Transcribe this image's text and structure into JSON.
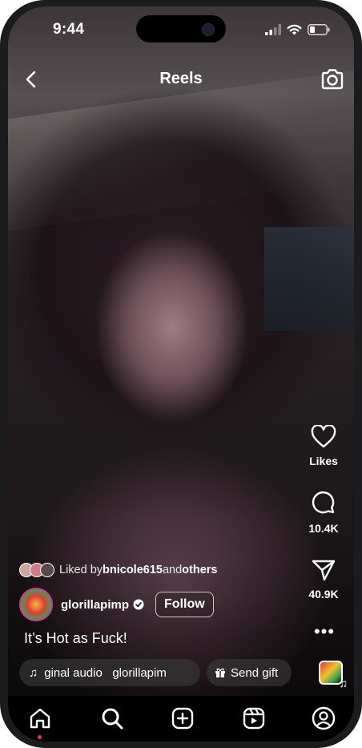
{
  "status_bar": {
    "time": "9:44"
  },
  "header": {
    "title": "Reels"
  },
  "rail": {
    "likes_label": "Likes",
    "comments_count": "10.4K",
    "shares_count": "40.9K"
  },
  "liked_by": {
    "prefix": "Liked by ",
    "user": "bnicole615",
    "middle": " and ",
    "others": "others"
  },
  "author": {
    "username": "glorillapimp",
    "follow_label": "Follow"
  },
  "caption": "It’s Hot as Fuck!",
  "chips": {
    "audio_text": "ginal audio   glorillapim",
    "gift_label": "Send gift"
  },
  "nav": {
    "items": [
      "home-icon",
      "search-icon",
      "create-icon",
      "reels-icon",
      "profile-icon"
    ],
    "notification_dot_color": "#ff3040"
  },
  "colors": {
    "accent_ring": "#d3359a",
    "text": "#ffffff"
  }
}
